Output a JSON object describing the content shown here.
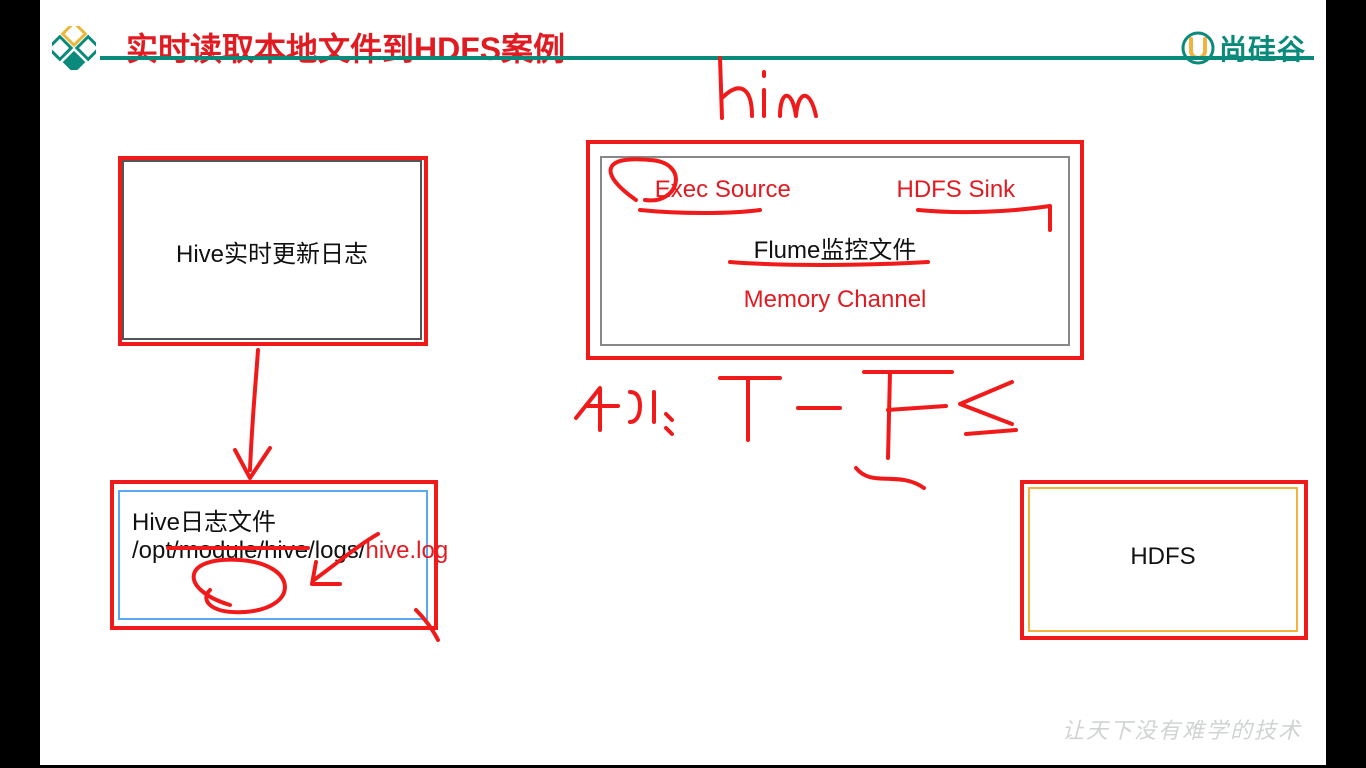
{
  "header": {
    "title": "实时读取本地文件到HDFS案例",
    "brand": "尚硅谷"
  },
  "box_hive_update": {
    "label": "Hive实时更新日志"
  },
  "box_flume": {
    "exec_source": "Exec Source",
    "hdfs_sink": "HDFS Sink",
    "flume_label": "Flume监控文件",
    "memory_channel": "Memory Channel"
  },
  "box_hive_logfile": {
    "line1": "Hive日志文件",
    "path_prefix": "/opt/module/hive/logs/",
    "filename": "hive.log"
  },
  "box_hdfs": {
    "label": "HDFS"
  },
  "footer": {
    "motto": "让天下没有难学的技术"
  },
  "annotations": {
    "top_scribble": "him",
    "middle_scribble": "tni I - F ≤"
  }
}
